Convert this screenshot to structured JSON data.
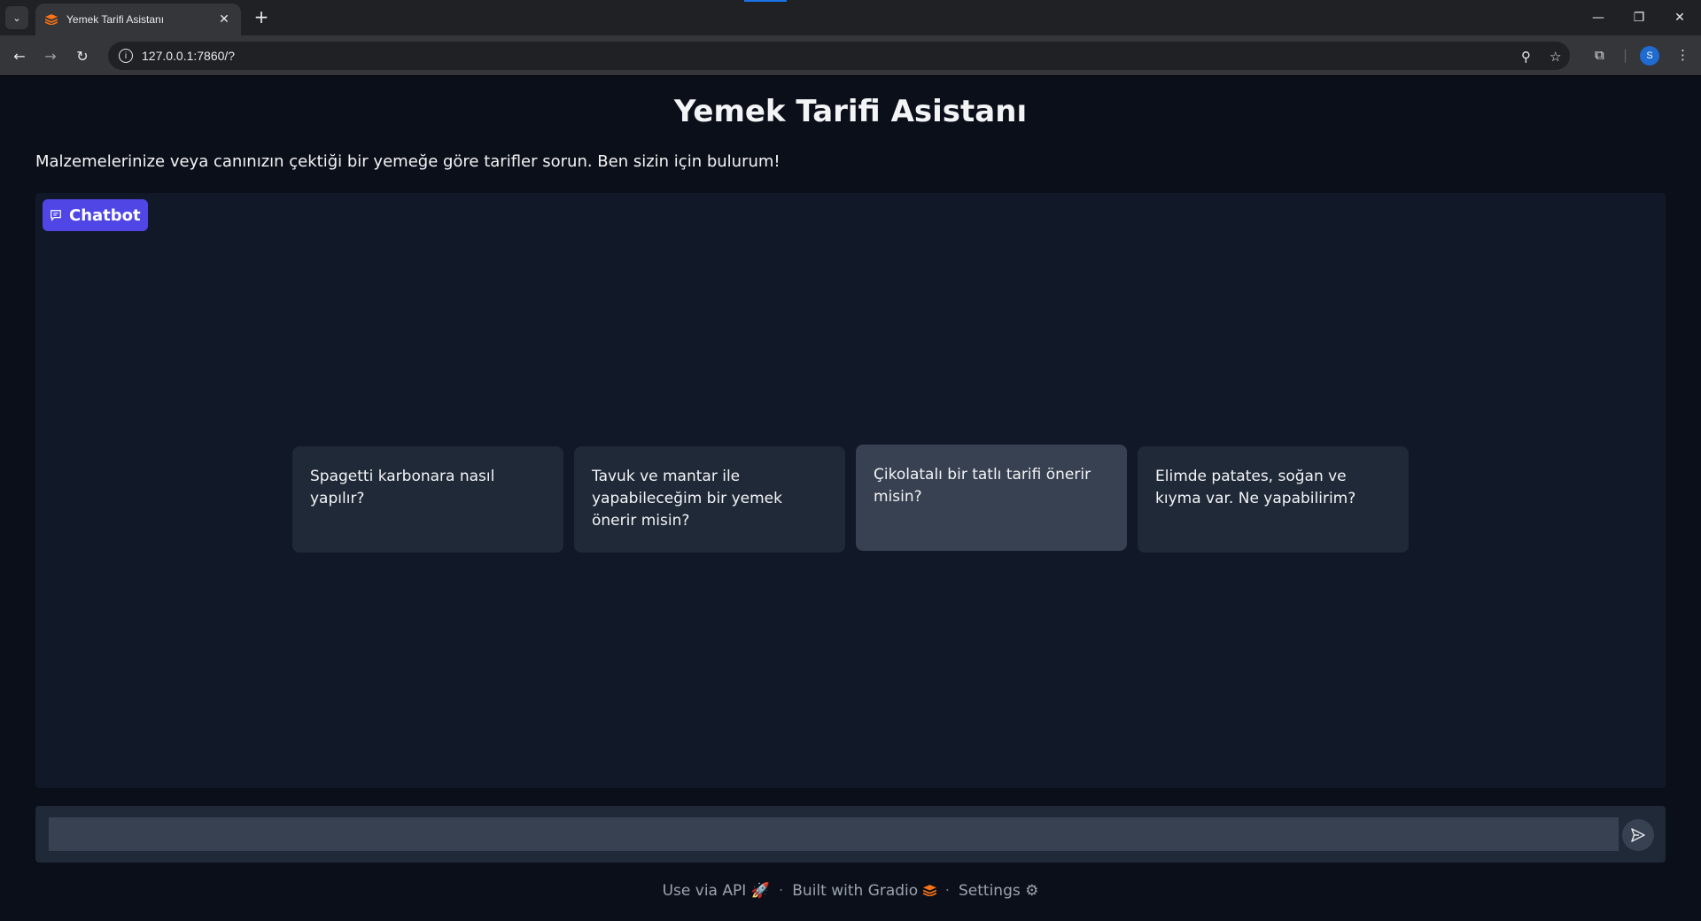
{
  "browser": {
    "tab_title": "Yemek Tarifi Asistanı",
    "url": "127.0.0.1:7860/?",
    "profile_initial": "S"
  },
  "page": {
    "title": "Yemek Tarifi Asistanı",
    "description": "Malzemelerinize veya canınızın çektiği bir yemeğe göre tarifler sorun. Ben sizin için bulurum!"
  },
  "chatbot": {
    "label": "Chatbot",
    "examples": [
      "Spagetti karbonara nasıl yapılır?",
      "Tavuk ve mantar ile yapabileceğim bir yemek önerir misin?",
      "Çikolatalı bir tatlı tarifi önerir misin?",
      "Elimde patates, soğan ve kıyma var. Ne yapabilirim?"
    ]
  },
  "input": {
    "value": "",
    "placeholder": ""
  },
  "footer": {
    "api": "Use via API",
    "built": "Built with Gradio",
    "settings": "Settings",
    "separator": "·"
  },
  "colors": {
    "accent": "#4f46e5",
    "background": "#0b0f19",
    "panel": "#111827",
    "gradio_orange": "#f97316"
  }
}
